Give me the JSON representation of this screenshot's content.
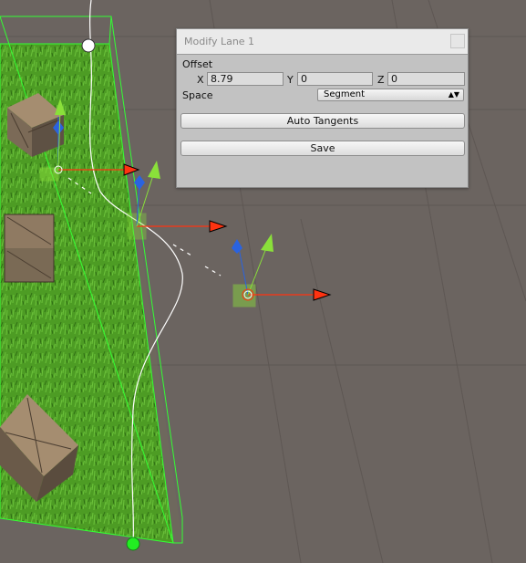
{
  "window": {
    "title": "Modify Lane 1"
  },
  "offset": {
    "label": "Offset",
    "x_label": "X",
    "x_value": "8.79",
    "y_label": "Y",
    "y_value": "0",
    "z_label": "Z",
    "z_value": "0"
  },
  "space": {
    "label": "Space",
    "selected": "Segment"
  },
  "buttons": {
    "auto_tangents": "Auto Tangents",
    "save": "Save"
  },
  "colors": {
    "ground": "#6b6460",
    "grass": "#4a9a22",
    "bounds": "#33ff33",
    "axis_x": "#ff3311",
    "axis_y": "#8ae03a",
    "axis_z": "#2a63e0",
    "spline": "#ffffff"
  }
}
